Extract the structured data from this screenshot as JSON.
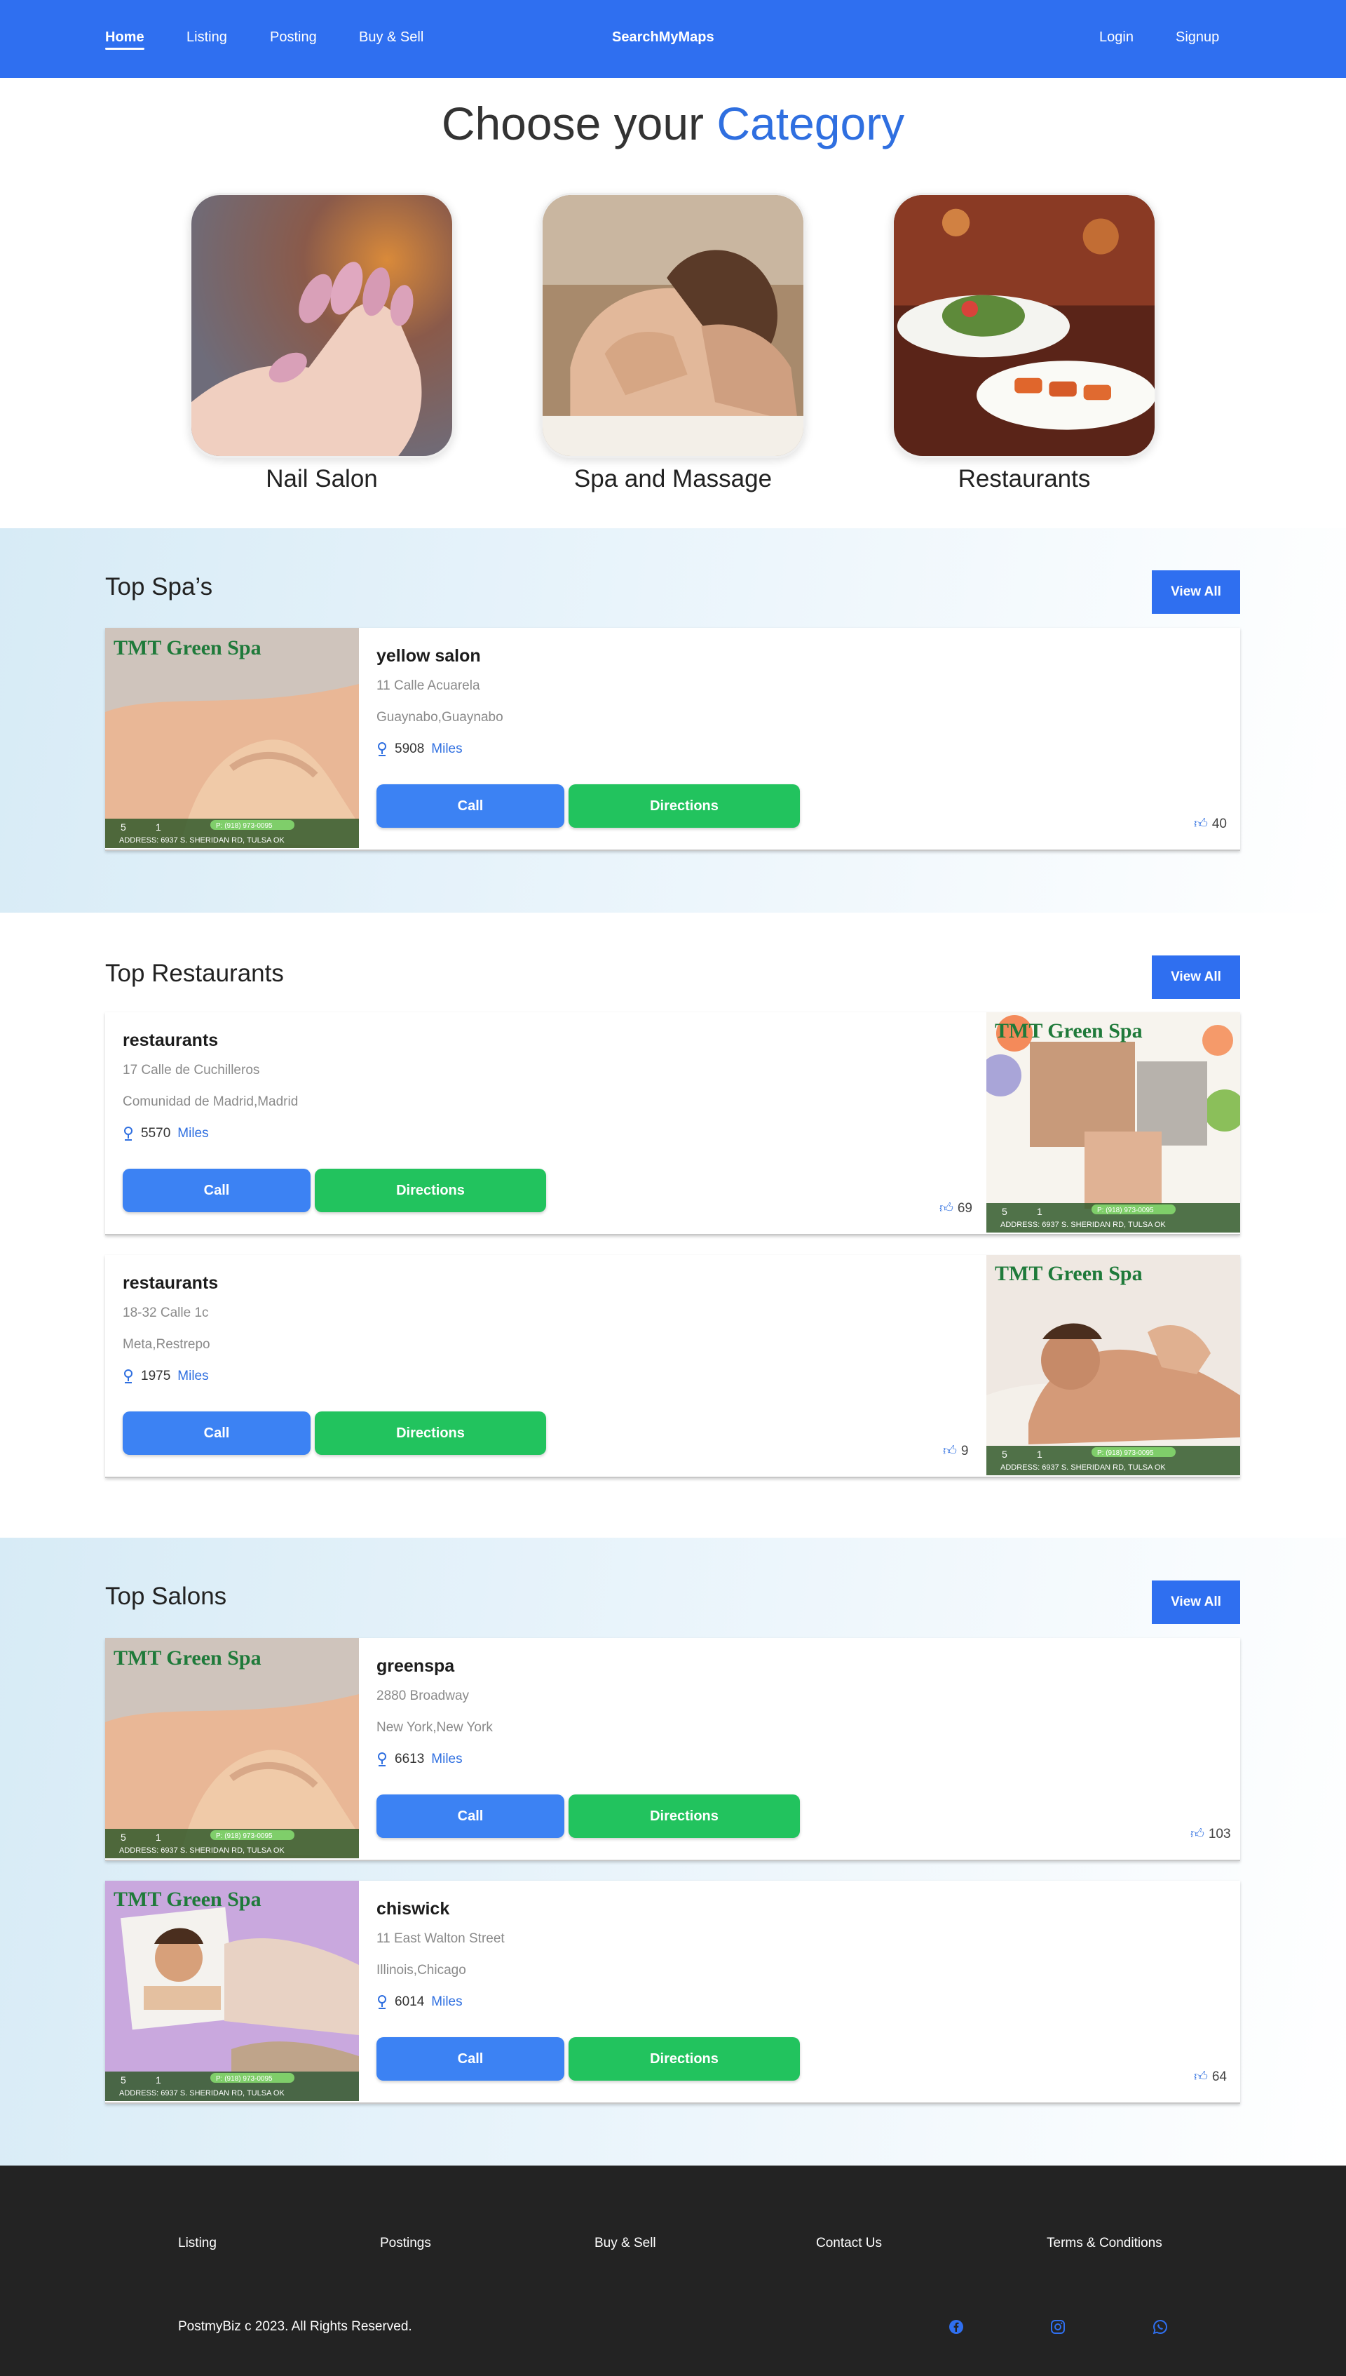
{
  "nav": {
    "links": [
      "Home",
      "Listing",
      "Posting",
      "Buy & Sell"
    ],
    "brand": "SearchMyMaps",
    "login": "Login",
    "signup": "Signup"
  },
  "categories": {
    "title_part1": "Choose your",
    "title_part2": "Category",
    "items": [
      "Nail Salon",
      "Spa and Massage",
      "Restaurants"
    ]
  },
  "sections": {
    "spas": {
      "title": "Top Spa’s",
      "view_all": "View All",
      "cards": [
        {
          "name": "yellow salon",
          "address1": "11 Calle Acuarela",
          "address2": "Guaynabo,Guaynabo",
          "distance": "5908",
          "unit": "Miles",
          "call": "Call",
          "directions": "Directions",
          "likes": "40"
        }
      ]
    },
    "restaurants": {
      "title": "Top Restaurants",
      "view_all": "View All",
      "cards": [
        {
          "name": "restaurants",
          "address1": "17 Calle de Cuchilleros",
          "address2": "Comunidad de Madrid,Madrid",
          "distance": "5570",
          "unit": "Miles",
          "call": "Call",
          "directions": "Directions",
          "likes": "69"
        },
        {
          "name": "restaurants",
          "address1": "18-32 Calle 1c",
          "address2": "Meta,Restrepo",
          "distance": "1975",
          "unit": "Miles",
          "call": "Call",
          "directions": "Directions",
          "likes": "9"
        }
      ]
    },
    "salons": {
      "title": "Top Salons",
      "view_all": "View All",
      "cards": [
        {
          "name": "greenspa",
          "address1": "2880 Broadway",
          "address2": "New York,New York",
          "distance": "6613",
          "unit": "Miles",
          "call": "Call",
          "directions": "Directions",
          "likes": "103"
        },
        {
          "name": "chiswick",
          "address1": "11 East Walton Street",
          "address2": "Illinois,Chicago",
          "distance": "6014",
          "unit": "Miles",
          "call": "Call",
          "directions": "Directions",
          "likes": "64"
        }
      ]
    }
  },
  "thumb_banner": {
    "brand": "TMT Green Spa",
    "photos": "5",
    "videos": "1",
    "phone": "P: (918) 973-0095",
    "address": "ADDRESS: 6937 S. SHERIDAN RD, TULSA OK"
  },
  "footer": {
    "links": [
      "Listing",
      "Postings",
      "Buy & Sell",
      "Contact Us",
      "Terms & Conditions"
    ],
    "copyright": "PostmyBiz c 2023. All Rights Reserved.",
    "social_icons": [
      "facebook-icon",
      "instagram-icon",
      "whatsapp-icon"
    ],
    "accent": "#2f6ff0"
  }
}
